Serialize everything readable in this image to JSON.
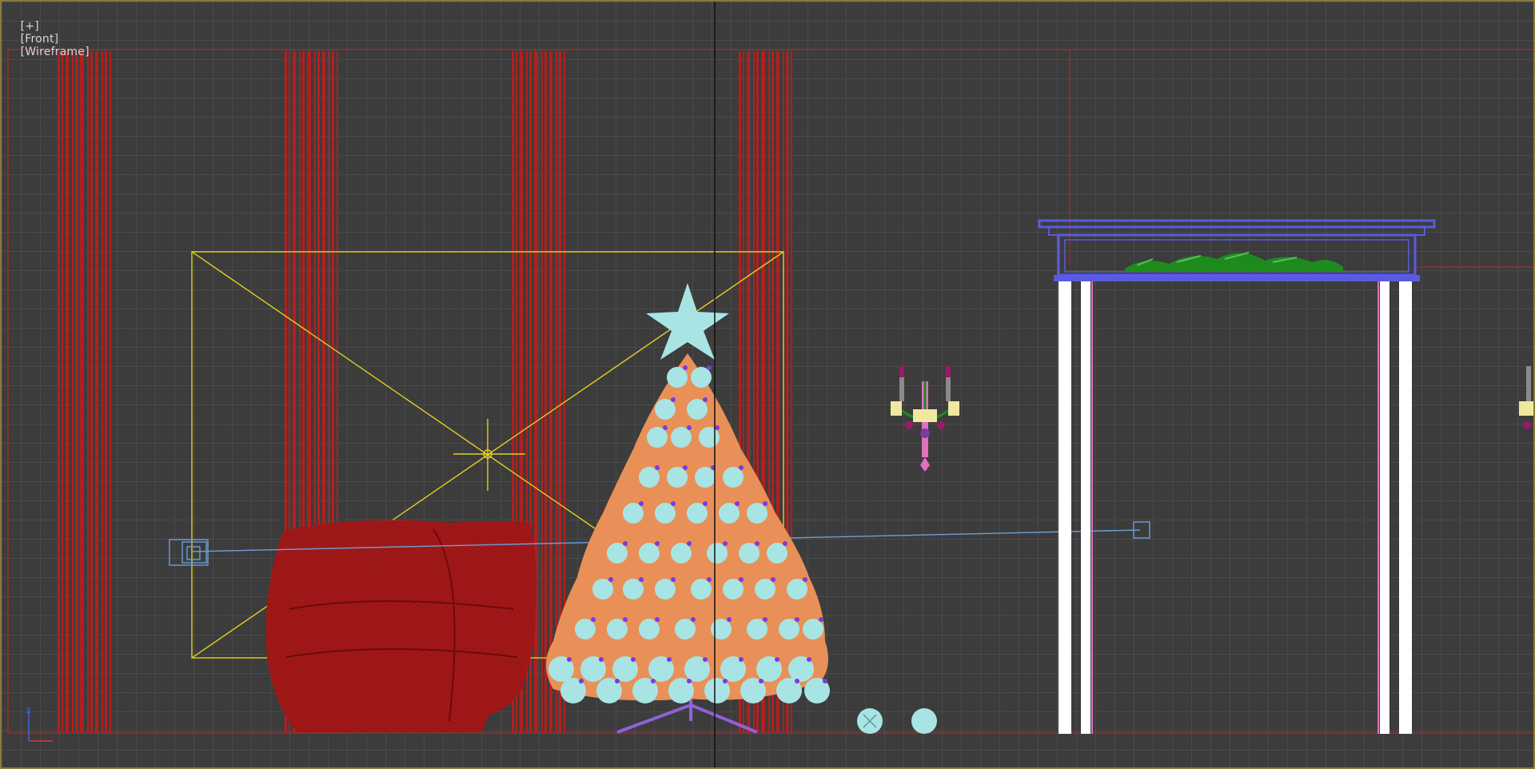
{
  "viewport": {
    "label_parts": [
      "[+]",
      "[Front]",
      "[Wireframe]"
    ],
    "view": "Front",
    "shading_mode": "Wireframe",
    "background_color": "#3c3c3c",
    "grid_color": "#5a5a5a",
    "border_color": "#8a7a3a"
  },
  "scene": {
    "objects": [
      {
        "name": "curtain",
        "count": 4,
        "color": "#b41e1e"
      },
      {
        "name": "armchair",
        "color": "#a81818"
      },
      {
        "name": "christmas-tree",
        "color": "#e89058",
        "ornament_color": "#a8e4e4",
        "star_color": "#a8e4e4"
      },
      {
        "name": "tree-stand",
        "color": "#9060d8"
      },
      {
        "name": "wall-sconce",
        "count": 2
      },
      {
        "name": "fireplace",
        "mantel_color": "#5a5ae0",
        "column_color": "#ffffff",
        "garland_color": "#1e8a1e"
      },
      {
        "name": "camera-target-box",
        "color": "#e0d020"
      },
      {
        "name": "light-line",
        "color": "#6aa0d8"
      },
      {
        "name": "floor-balls",
        "count": 2,
        "color": "#a8e4e4"
      }
    ]
  },
  "axis_gizmo": {
    "axes": [
      "Z",
      "X"
    ],
    "colors": [
      "#3a6ad8",
      "#d83a3a"
    ]
  }
}
